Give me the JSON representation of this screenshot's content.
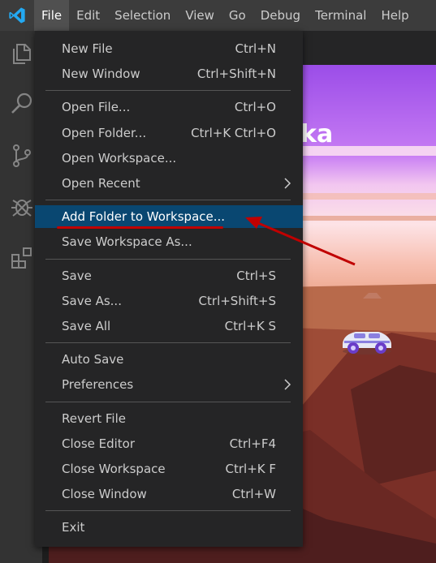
{
  "menubar": {
    "logo_icon": "vscode-logo-icon",
    "items": [
      {
        "label": "File",
        "active": true
      },
      {
        "label": "Edit"
      },
      {
        "label": "Selection"
      },
      {
        "label": "View"
      },
      {
        "label": "Go"
      },
      {
        "label": "Debug"
      },
      {
        "label": "Terminal"
      },
      {
        "label": "Help"
      }
    ]
  },
  "activitybar": {
    "icons": [
      "explorer-icon",
      "search-icon",
      "source-control-icon",
      "debug-icon",
      "extensions-icon"
    ]
  },
  "file_menu": {
    "groups": [
      [
        {
          "label": "New File",
          "shortcut": "Ctrl+N"
        },
        {
          "label": "New Window",
          "shortcut": "Ctrl+Shift+N"
        }
      ],
      [
        {
          "label": "Open File...",
          "shortcut": "Ctrl+O"
        },
        {
          "label": "Open Folder...",
          "shortcut": "Ctrl+K Ctrl+O"
        },
        {
          "label": "Open Workspace...",
          "shortcut": ""
        },
        {
          "label": "Open Recent",
          "shortcut": "",
          "submenu": true
        }
      ],
      [
        {
          "label": "Add Folder to Workspace...",
          "shortcut": "",
          "highlighted": true
        },
        {
          "label": "Save Workspace As...",
          "shortcut": ""
        }
      ],
      [
        {
          "label": "Save",
          "shortcut": "Ctrl+S"
        },
        {
          "label": "Save As...",
          "shortcut": "Ctrl+Shift+S"
        },
        {
          "label": "Save All",
          "shortcut": "Ctrl+K S"
        }
      ],
      [
        {
          "label": "Auto Save",
          "shortcut": ""
        },
        {
          "label": "Preferences",
          "shortcut": "",
          "submenu": true
        }
      ],
      [
        {
          "label": "Revert File",
          "shortcut": ""
        },
        {
          "label": "Close Editor",
          "shortcut": "Ctrl+F4"
        },
        {
          "label": "Close Workspace",
          "shortcut": "Ctrl+K F"
        },
        {
          "label": "Close Window",
          "shortcut": "Ctrl+W"
        }
      ],
      [
        {
          "label": "Exit",
          "shortcut": ""
        }
      ]
    ]
  },
  "welcome": {
    "title": "ka"
  },
  "colors": {
    "menubar_bg": "#3c3c3c",
    "menu_bg": "#252526",
    "highlight_bg": "#094771",
    "annotation": "#c00000"
  }
}
